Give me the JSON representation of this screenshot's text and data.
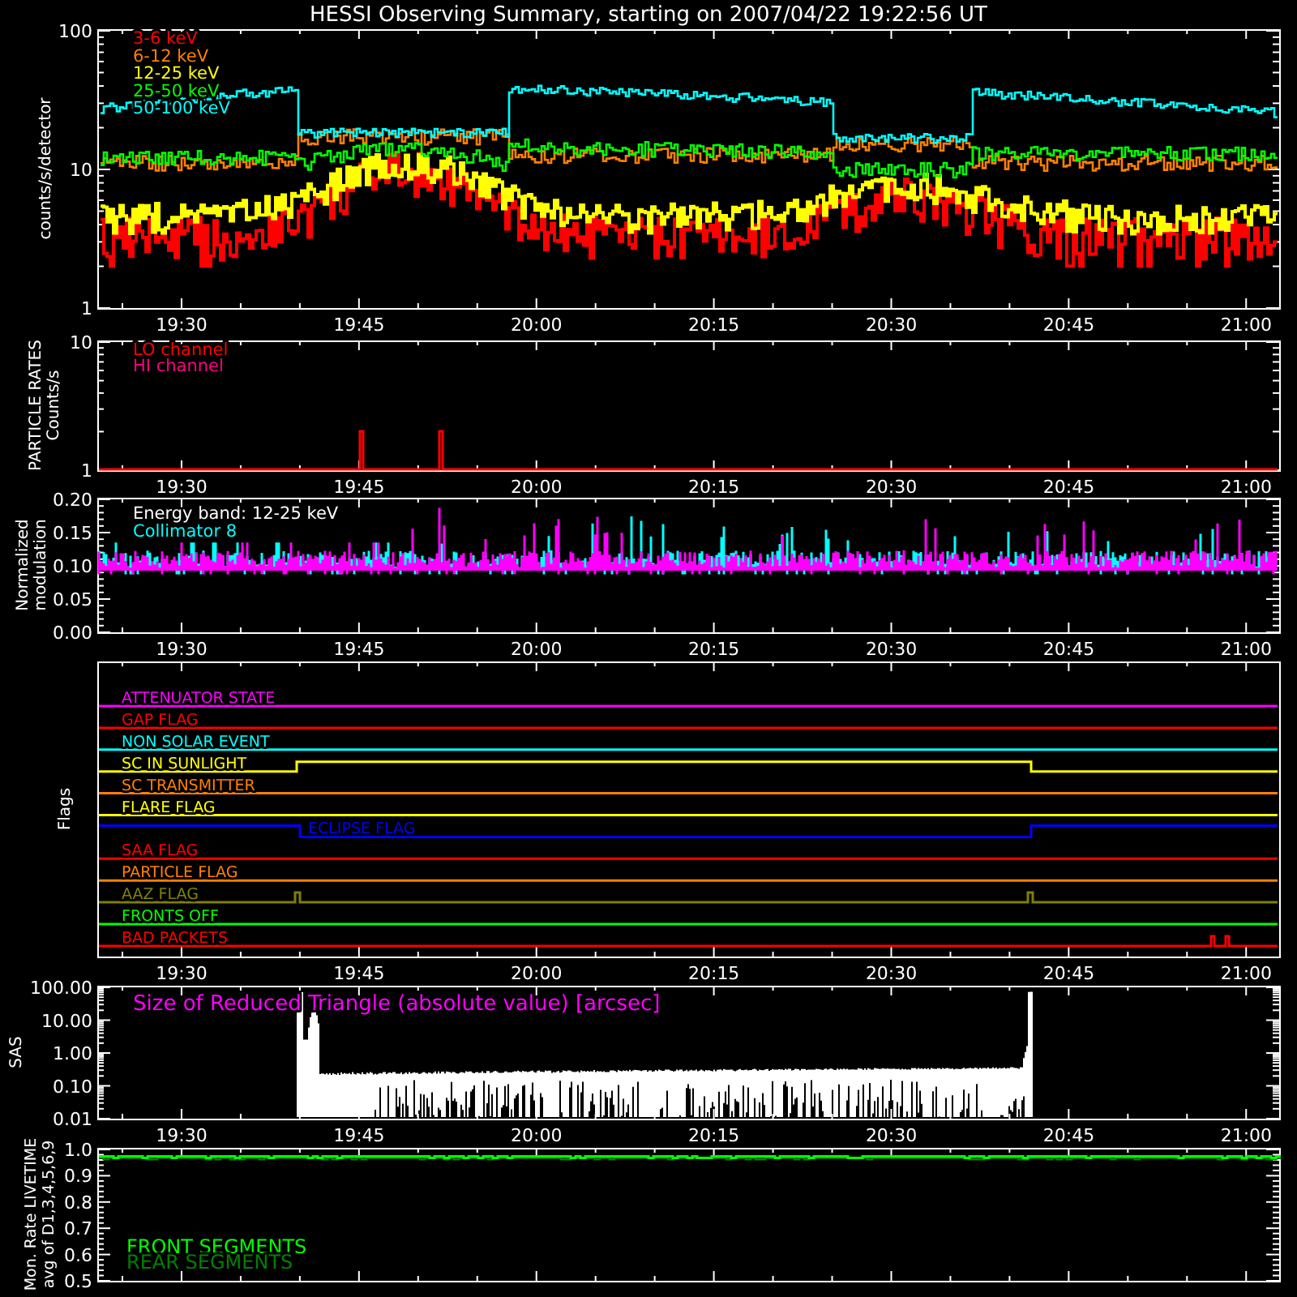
{
  "title": "HESSI Observing Summary, starting on 2007/04/22 19:22:56 UT",
  "panels": [
    {
      "kind": "counts",
      "ylabel": [
        "counts/s/detector"
      ],
      "yticks": [
        "100",
        "10",
        "1"
      ],
      "legend": [
        {
          "label": "3-6 keV",
          "color": "#ff0000"
        },
        {
          "label": "6-12 keV",
          "color": "#ff8000"
        },
        {
          "label": "12-25 keV",
          "color": "#ffff00"
        },
        {
          "label": "25-50 keV",
          "color": "#00ff00"
        },
        {
          "label": "50-100 keV",
          "color": "#00ffff"
        }
      ],
      "xtick_labels": [
        "19:30",
        "19:45",
        "20:00",
        "20:15",
        "20:30",
        "20:45",
        "21:00"
      ]
    },
    {
      "kind": "particle",
      "ylabel": [
        "PARTICLE RATES",
        "Counts/s"
      ],
      "yticks": [
        "10",
        "1"
      ],
      "legend": [
        {
          "label": "LO channel",
          "color": "#ff0000"
        },
        {
          "label": "HI channel",
          "color": "#ff0080"
        }
      ],
      "xtick_labels": [
        "19:30",
        "19:45",
        "20:00",
        "20:15",
        "20:30",
        "20:45",
        "21:00"
      ]
    },
    {
      "kind": "modulation",
      "ylabel": [
        "Normalized",
        "modulation"
      ],
      "yticks": [
        "0.20",
        "0.15",
        "0.10",
        "0.05",
        "0.00"
      ],
      "note": "Energy band: 12-25 keV",
      "legend": [
        {
          "label": "Collimator 8",
          "color": "#00ffff"
        }
      ],
      "xtick_labels": [
        "19:30",
        "19:45",
        "20:00",
        "20:15",
        "20:30",
        "20:45",
        "21:00"
      ]
    },
    {
      "kind": "flags",
      "ylabel": [
        "Flags"
      ],
      "flags": [
        {
          "label": "ATTENUATOR STATE",
          "color": "#ff00ff"
        },
        {
          "label": "GAP FLAG",
          "color": "#ff0000"
        },
        {
          "label": "NON SOLAR EVENT",
          "color": "#00ffff"
        },
        {
          "label": "SC IN SUNLIGHT",
          "color": "#ffff00"
        },
        {
          "label": "SC TRANSMITTER",
          "color": "#ff8000"
        },
        {
          "label": "FLARE FLAG",
          "color": "#ffff00"
        },
        {
          "label": "ECLIPSE FLAG",
          "color": "#0000ff"
        },
        {
          "label": "SAA FLAG",
          "color": "#ff0000"
        },
        {
          "label": "PARTICLE FLAG",
          "color": "#ff8000"
        },
        {
          "label": "AAZ FLAG",
          "color": "#808000"
        },
        {
          "label": "FRONTS OFF",
          "color": "#00ff00"
        },
        {
          "label": "BAD PACKETS",
          "color": "#ff0000"
        }
      ],
      "xtick_labels": [
        "19:30",
        "19:45",
        "20:00",
        "20:15",
        "20:30",
        "20:45",
        "21:00"
      ]
    },
    {
      "kind": "sas",
      "ylabel": [
        "SAS"
      ],
      "yticks": [
        "100.00",
        "10.00",
        "1.00",
        "0.10",
        "0.01"
      ],
      "note": "Size of Reduced Triangle (absolute value) [arcsec]",
      "xtick_labels": [
        "19:30",
        "19:45",
        "20:00",
        "20:15",
        "20:30",
        "20:45",
        "21:00"
      ]
    },
    {
      "kind": "livetime",
      "ylabel": [
        "Mon. Rate LIVETIME",
        "avg of D1,3,4,5,6,9"
      ],
      "yticks": [
        "1.0",
        "0.9",
        "0.8",
        "0.7",
        "0.6",
        "0.5"
      ],
      "legend": [
        {
          "label": "FRONT SEGMENTS",
          "color": "#00ff00"
        },
        {
          "label": "REAR SEGMENTS",
          "color": "#008000"
        }
      ]
    }
  ]
}
